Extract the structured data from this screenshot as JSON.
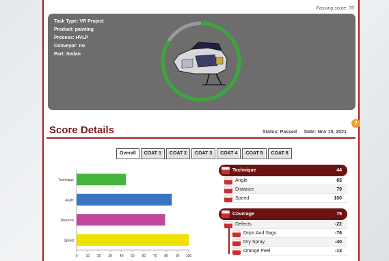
{
  "passing_score": "Passing score: 70",
  "task_info": {
    "task_type": "Task Type: VR Project",
    "product": "Product: painting",
    "process": "Process: HVLP",
    "conveyor": "Conveyor: no",
    "part": "Part: Sedan"
  },
  "overall_ring": {
    "fraction": 0.84,
    "color": "#3aa73a",
    "track_color": "#9a9a9a"
  },
  "help_icon_glyph": "?",
  "score_details": {
    "title": "Score Details",
    "status": "Status: Passed",
    "date": "Date: Nov 15, 2021"
  },
  "tabs": [
    "Overall",
    "COAT 1",
    "COAT 2",
    "COAT 3",
    "COAT 4",
    "COAT 5",
    "COAT 6"
  ],
  "chart_data": {
    "type": "bar",
    "orientation": "horizontal",
    "categories": [
      "Technique",
      "Angle",
      "Distance",
      "Speed"
    ],
    "values": [
      44,
      85,
      79,
      100
    ],
    "colors": [
      "#44b53d",
      "#3b75c1",
      "#c0479b",
      "#efe100"
    ],
    "xlim": [
      0,
      100
    ],
    "xticks": [
      "0",
      "10",
      "20",
      "30",
      "40",
      "50",
      "60",
      "70",
      "80",
      "90",
      "100"
    ]
  },
  "scores": {
    "technique": {
      "label": "Technique",
      "value": "44",
      "items": [
        {
          "label": "Angle",
          "value": "85"
        },
        {
          "label": "Distance",
          "value": "79"
        },
        {
          "label": "Speed",
          "value": "100"
        }
      ]
    },
    "coverage": {
      "label": "Coverage",
      "value": "79",
      "defects": {
        "label": "Defects",
        "value": "-22"
      },
      "sub_items": [
        {
          "label": "Drips And Sags",
          "value": "-76"
        },
        {
          "label": "Dry Spray",
          "value": "-40"
        },
        {
          "label": "Orange Peel",
          "value": "-13"
        }
      ]
    }
  }
}
